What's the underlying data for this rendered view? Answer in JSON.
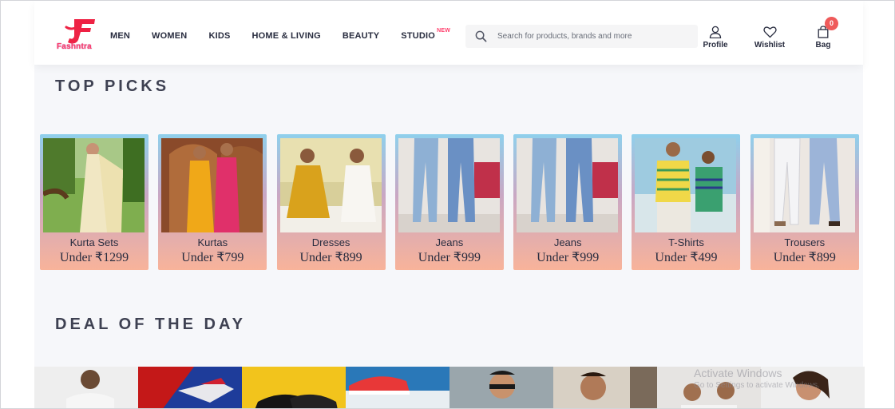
{
  "brand": {
    "name": "Fashntra",
    "accent": "#ff3f6c",
    "logo_color": "#ee2244"
  },
  "nav": {
    "items": [
      {
        "label": "MEN"
      },
      {
        "label": "WOMEN"
      },
      {
        "label": "KIDS"
      },
      {
        "label": "HOME & LIVING"
      },
      {
        "label": "BEAUTY"
      },
      {
        "label": "STUDIO",
        "badge": "NEW"
      }
    ]
  },
  "search": {
    "placeholder": "Search for products, brands and more",
    "icon": "search-icon"
  },
  "actions": {
    "profile": {
      "label": "Profile",
      "icon": "user-icon"
    },
    "wishlist": {
      "label": "Wishlist",
      "icon": "heart-icon"
    },
    "bag": {
      "label": "Bag",
      "icon": "bag-icon",
      "count": "0"
    }
  },
  "sections": {
    "top_picks": {
      "title": "TOP PICKS"
    },
    "deal_of_the_day": {
      "title": "DEAL OF THE DAY"
    }
  },
  "top_picks": [
    {
      "name": "Kurta Sets",
      "price": "Under ₹1299"
    },
    {
      "name": "Kurtas",
      "price": "Under ₹799"
    },
    {
      "name": "Dresses",
      "price": "Under ₹899"
    },
    {
      "name": "Jeans",
      "price": "Under ₹999"
    },
    {
      "name": "Jeans",
      "price": "Under ₹999"
    },
    {
      "name": "T-Shirts",
      "price": "Under ₹499"
    },
    {
      "name": "Trousers",
      "price": "Under ₹899"
    }
  ],
  "deals_count": 8,
  "watermark": {
    "title": "Activate Windows",
    "subtitle": "Go to Settings to activate Windows."
  }
}
